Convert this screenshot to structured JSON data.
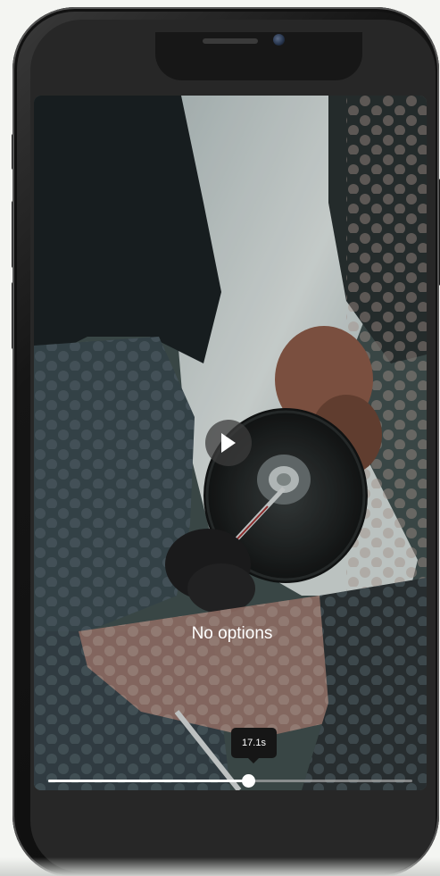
{
  "video": {
    "overlay_message": "No options",
    "current_time_label": "17.1s",
    "progress_fraction": 0.55
  },
  "icons": {
    "play": "play-icon"
  }
}
